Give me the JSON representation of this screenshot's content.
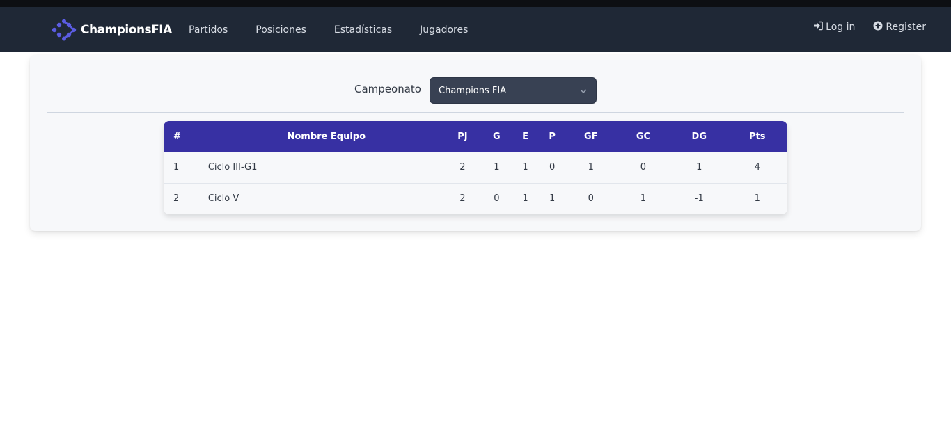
{
  "brand": {
    "name": "ChampionsFIA",
    "accent": "#5b5ce2"
  },
  "nav": {
    "links": [
      "Partidos",
      "Posiciones",
      "Estadísticas",
      "Jugadores"
    ],
    "login": "Log in",
    "register": "Register"
  },
  "filter": {
    "label": "Campeonato",
    "selected": "Champions FIA"
  },
  "table": {
    "headers": [
      "#",
      "Nombre Equipo",
      "PJ",
      "G",
      "E",
      "P",
      "GF",
      "GC",
      "DG",
      "Pts"
    ],
    "rows": [
      [
        "1",
        "Ciclo III-G1",
        "2",
        "1",
        "1",
        "0",
        "1",
        "0",
        "1",
        "4"
      ],
      [
        "2",
        "Ciclo V",
        "2",
        "0",
        "1",
        "1",
        "0",
        "1",
        "-1",
        "1"
      ]
    ]
  },
  "colors": {
    "navbar": "#1f2836",
    "table_header": "#3730a3",
    "select_bg": "#384153"
  }
}
